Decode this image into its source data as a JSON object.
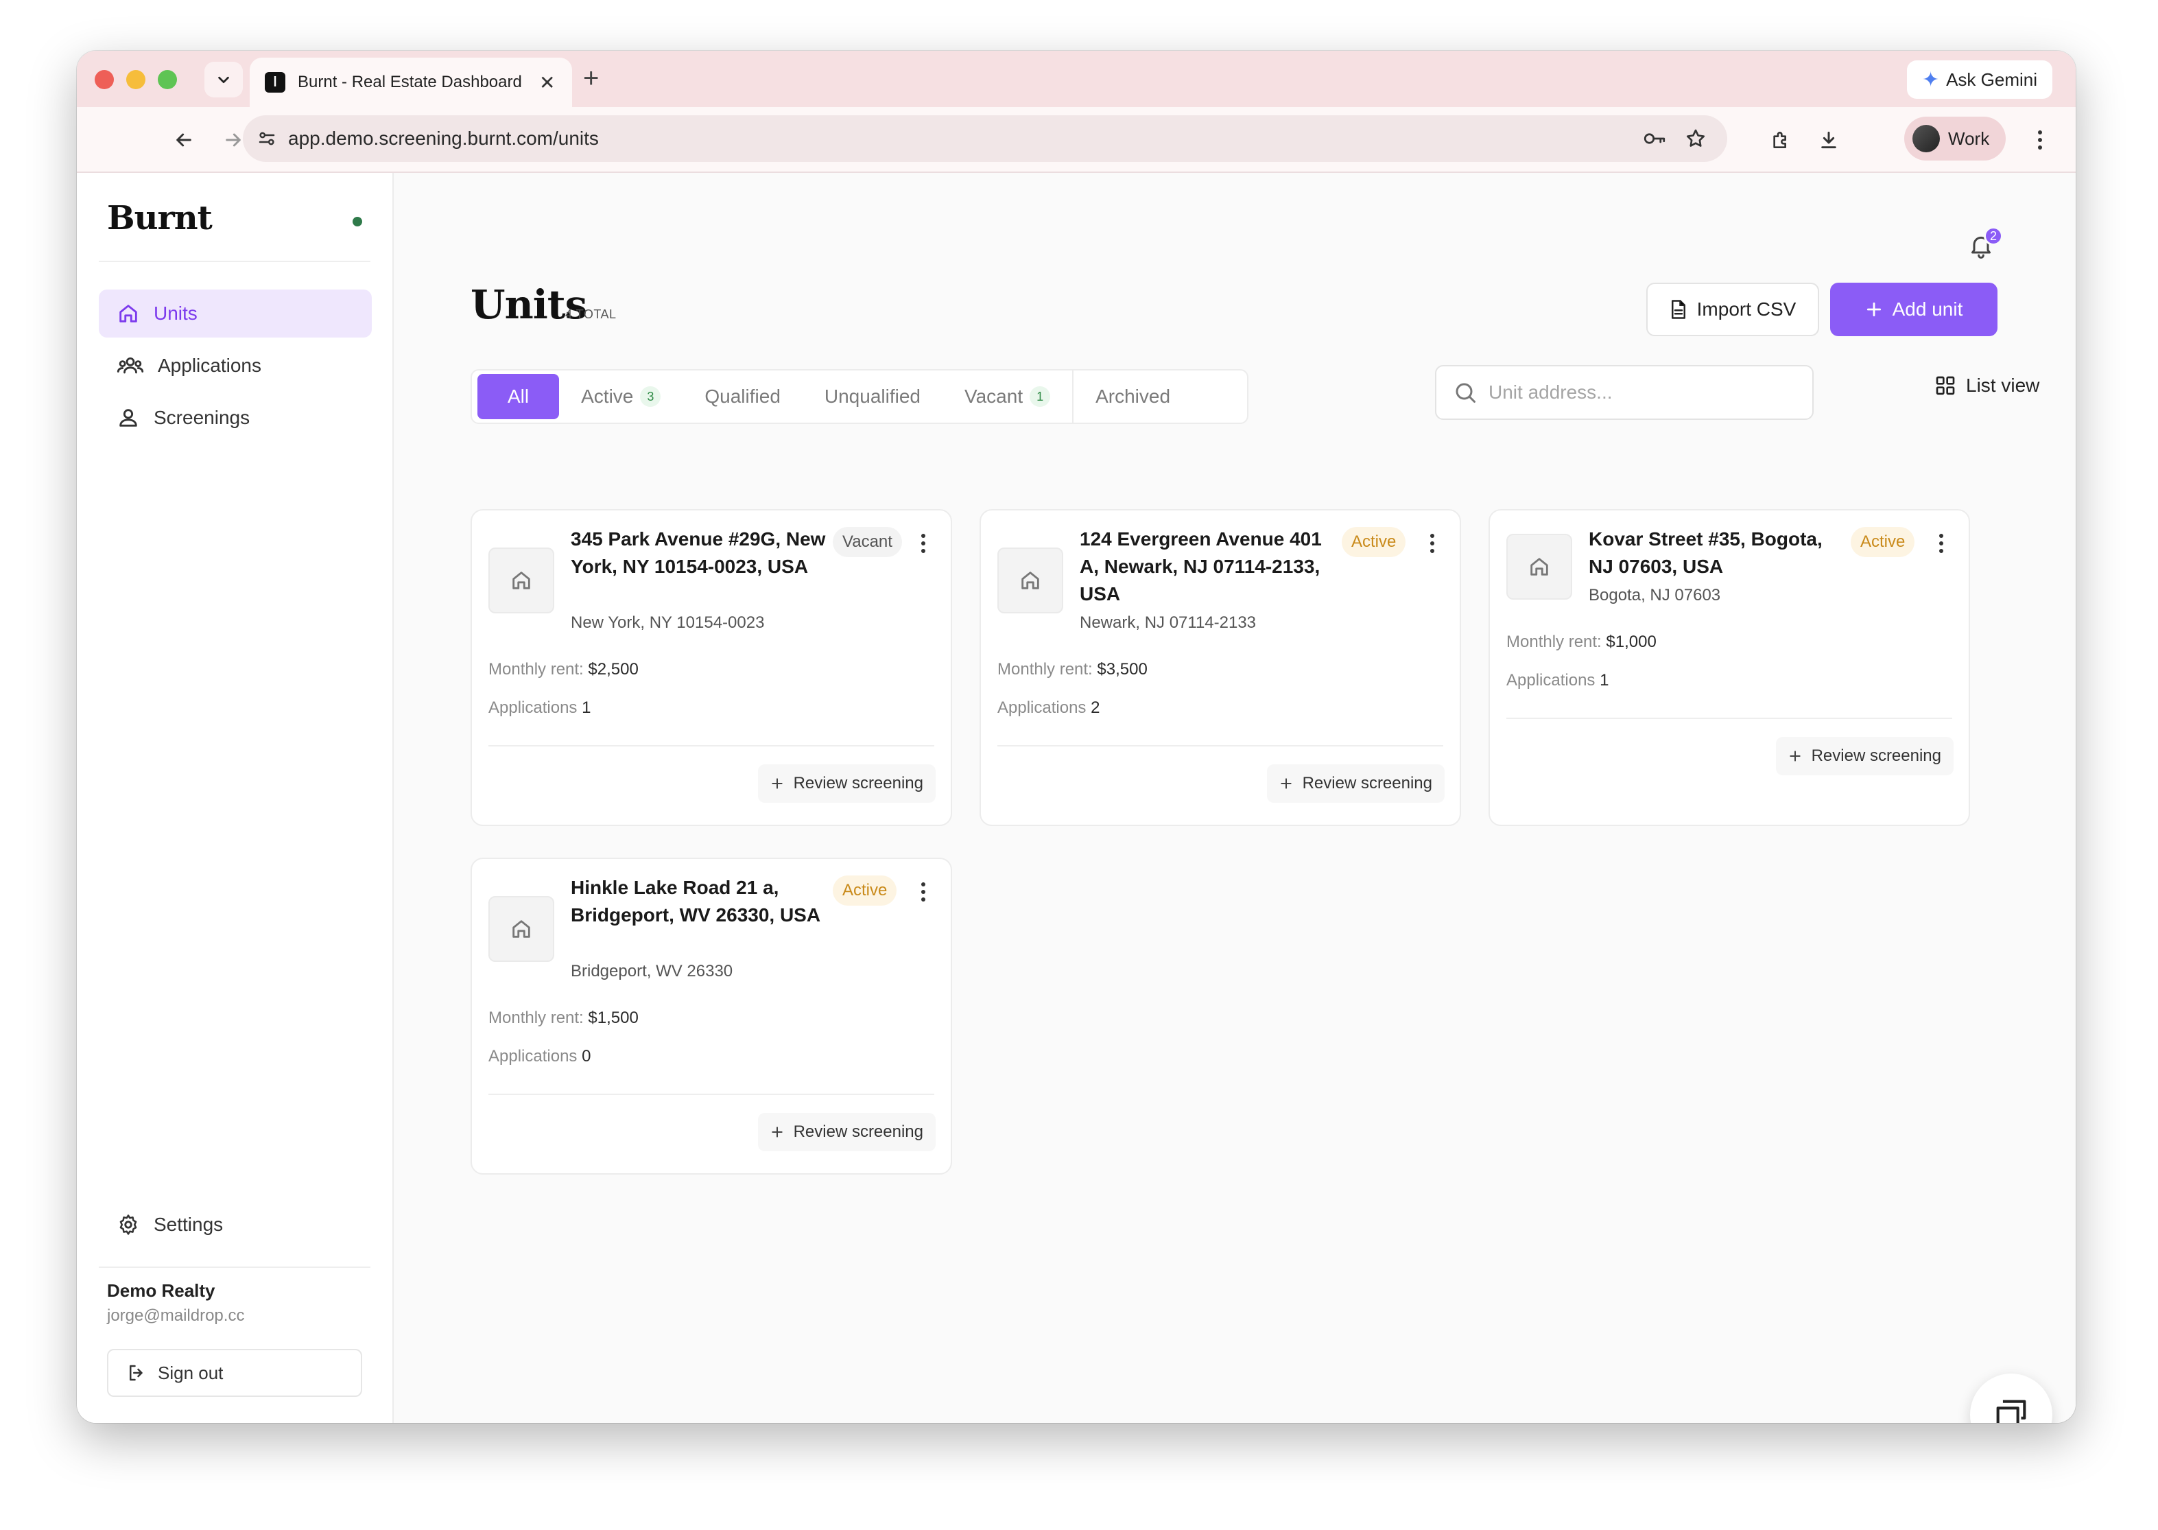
{
  "browser": {
    "tab_title": "Burnt - Real Estate Dashboard",
    "url": "app.demo.screening.burnt.com/units",
    "ask_gemini": "Ask Gemini",
    "profile": "Work"
  },
  "sidebar": {
    "brand": "Burnt",
    "items": [
      {
        "label": "Units",
        "icon": "home-icon",
        "active": true
      },
      {
        "label": "Applications",
        "icon": "users-icon",
        "active": false
      },
      {
        "label": "Screenings",
        "icon": "user-icon",
        "active": false
      }
    ],
    "settings": "Settings",
    "account_name": "Demo Realty",
    "account_email": "jorge@maildrop.cc",
    "sign_out": "Sign out"
  },
  "header": {
    "notification_count": "2",
    "title": "Units",
    "count": "4 TOTAL",
    "import_csv": "Import CSV",
    "add_unit": "Add unit"
  },
  "filters": {
    "tabs": [
      {
        "label": "All",
        "count": null,
        "active": true
      },
      {
        "label": "Active",
        "count": "3",
        "active": false
      },
      {
        "label": "Qualified",
        "count": null,
        "active": false
      },
      {
        "label": "Unqualified",
        "count": null,
        "active": false
      },
      {
        "label": "Vacant",
        "count": "1",
        "active": false
      },
      {
        "label": "Archived",
        "count": null,
        "active": false
      }
    ],
    "search_placeholder": "Unit address...",
    "list_view": "List view"
  },
  "units": [
    {
      "title": "345 Park Avenue #29G, New York, NY 10154-0023, USA",
      "status": "Vacant",
      "city": "New York, NY 10154-0023",
      "rent_label": "Monthly rent:",
      "rent": "$2,500",
      "apps_label": "Applications",
      "apps": "1",
      "action": "Review screening"
    },
    {
      "title": "124 Evergreen Avenue 401 A, Newark, NJ 07114-2133, USA",
      "status": "Active",
      "city": "Newark, NJ 07114-2133",
      "rent_label": "Monthly rent:",
      "rent": "$3,500",
      "apps_label": "Applications",
      "apps": "2",
      "action": "Review screening"
    },
    {
      "title": "Kovar Street #35, Bogota, NJ 07603, USA",
      "status": "Active",
      "city": "Bogota, NJ 07603",
      "rent_label": "Monthly rent:",
      "rent": "$1,000",
      "apps_label": "Applications",
      "apps": "1",
      "action": "Review screening"
    },
    {
      "title": "Hinkle Lake Road 21 a, Bridgeport, WV 26330, USA",
      "status": "Active",
      "city": "Bridgeport, WV 26330",
      "rent_label": "Monthly rent:",
      "rent": "$1,500",
      "apps_label": "Applications",
      "apps": "0",
      "action": "Review screening"
    }
  ],
  "colors": {
    "accent": "#8b5cf6",
    "accent_bg": "#efe7fd",
    "active_badge": "#c98a1a",
    "count_badge": "#2f8b46"
  }
}
